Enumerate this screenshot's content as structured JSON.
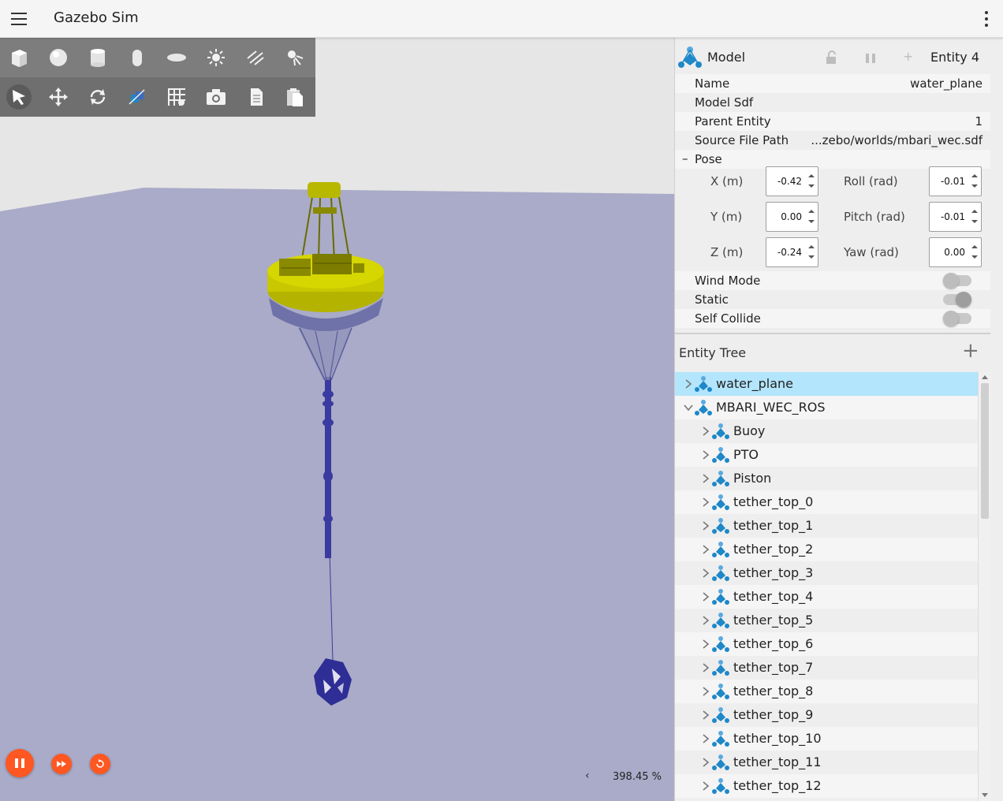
{
  "app": {
    "title": "Gazebo Sim"
  },
  "toolbar": {
    "row1": [
      "box-icon",
      "sphere-icon",
      "cylinder-icon",
      "capsule-icon",
      "ellipsoid-icon",
      "sun-light-icon",
      "directional-light-icon",
      "spot-light-icon"
    ],
    "row2": [
      "select-tool-icon",
      "translate-tool-icon",
      "rotate-tool-icon",
      "transform-icon",
      "grid-icon",
      "screenshot-icon",
      "copy-icon",
      "paste-icon"
    ]
  },
  "playback": {
    "rtf": "398.45 %",
    "rtf_toggle": "‹"
  },
  "component_inspector": {
    "header": {
      "label": "Model",
      "entity": "Entity 4"
    },
    "rows": [
      {
        "label": "Name",
        "value": "water_plane"
      },
      {
        "label": "Model Sdf",
        "value": ""
      },
      {
        "label": "Parent Entity",
        "value": "1"
      },
      {
        "label": "Source File Path",
        "value": "...zebo/worlds/mbari_wec.sdf"
      }
    ],
    "pose": {
      "label": "Pose",
      "toggle": "–",
      "fields": [
        {
          "label": "X (m)",
          "value": "-0.42"
        },
        {
          "label": "Roll (rad)",
          "value": "-0.01"
        },
        {
          "label": "Y (m)",
          "value": "0.00"
        },
        {
          "label": "Pitch (rad)",
          "value": "-0.01"
        },
        {
          "label": "Z (m)",
          "value": "-0.24"
        },
        {
          "label": "Yaw (rad)",
          "value": "0.00"
        }
      ]
    },
    "toggles": [
      {
        "label": "Wind Mode",
        "on": false
      },
      {
        "label": "Static",
        "on": true
      },
      {
        "label": "Self Collide",
        "on": false
      }
    ]
  },
  "entity_tree": {
    "title": "Entity Tree",
    "add": "+",
    "items": [
      {
        "name": "water_plane",
        "level": 0,
        "expanded": false,
        "selected": true
      },
      {
        "name": "MBARI_WEC_ROS",
        "level": 0,
        "expanded": true,
        "selected": false
      },
      {
        "name": "Buoy",
        "level": 1,
        "expanded": false,
        "selected": false
      },
      {
        "name": "PTO",
        "level": 1,
        "expanded": false,
        "selected": false
      },
      {
        "name": "Piston",
        "level": 1,
        "expanded": false,
        "selected": false
      },
      {
        "name": "tether_top_0",
        "level": 1,
        "expanded": false,
        "selected": false
      },
      {
        "name": "tether_top_1",
        "level": 1,
        "expanded": false,
        "selected": false
      },
      {
        "name": "tether_top_2",
        "level": 1,
        "expanded": false,
        "selected": false
      },
      {
        "name": "tether_top_3",
        "level": 1,
        "expanded": false,
        "selected": false
      },
      {
        "name": "tether_top_4",
        "level": 1,
        "expanded": false,
        "selected": false
      },
      {
        "name": "tether_top_5",
        "level": 1,
        "expanded": false,
        "selected": false
      },
      {
        "name": "tether_top_6",
        "level": 1,
        "expanded": false,
        "selected": false
      },
      {
        "name": "tether_top_7",
        "level": 1,
        "expanded": false,
        "selected": false
      },
      {
        "name": "tether_top_8",
        "level": 1,
        "expanded": false,
        "selected": false
      },
      {
        "name": "tether_top_9",
        "level": 1,
        "expanded": false,
        "selected": false
      },
      {
        "name": "tether_top_10",
        "level": 1,
        "expanded": false,
        "selected": false
      },
      {
        "name": "tether_top_11",
        "level": 1,
        "expanded": false,
        "selected": false
      },
      {
        "name": "tether_top_12",
        "level": 1,
        "expanded": false,
        "selected": false
      }
    ]
  },
  "colors": {
    "accent": "#ff5722",
    "selection": "#b3e5fc",
    "water": "#a9abc8",
    "sky": "#e6e6e6",
    "buoy": "#c8c800",
    "tether": "#3a3aa0",
    "model_icon": "#1e88c8"
  }
}
